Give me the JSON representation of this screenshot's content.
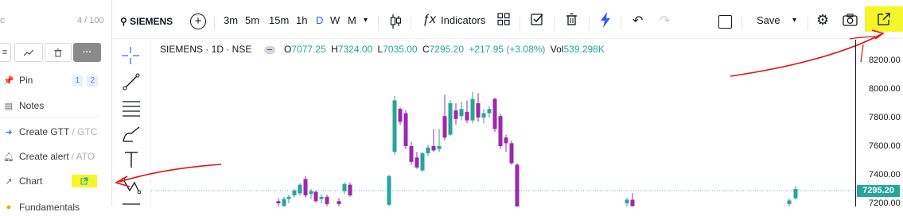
{
  "left_panel": {
    "search_fragment": "c",
    "count": "4 / 100",
    "items": [
      {
        "label": "Pin",
        "badges": [
          "1",
          "2"
        ]
      },
      {
        "label": "Notes"
      },
      {
        "label": "Create GTT",
        "suffix": "/ GTC"
      },
      {
        "label": "Create alert",
        "suffix": "/ ATO"
      },
      {
        "label": "Chart"
      },
      {
        "label": "Fundamentals"
      }
    ]
  },
  "toolbar": {
    "symbol": "SIEMENS",
    "intervals": [
      "3m",
      "5m",
      "15m",
      "1h",
      "D",
      "W",
      "M"
    ],
    "active_interval": "D",
    "indicators_label": "Indicators",
    "save_label": "Save"
  },
  "info": {
    "title": "SIEMENS · 1D · NSE",
    "o_label": "O",
    "o": "7077.25",
    "h_label": "H",
    "h": "7324.00",
    "l_label": "L",
    "l": "7035.00",
    "c_label": "C",
    "c": "7295.20",
    "change": "+217.95 (+3.08%)",
    "vol_label": "Vol",
    "vol": "539.298K"
  },
  "price_axis": {
    "ticks": [
      "8200.00",
      "8000.00",
      "7800.00",
      "7600.00",
      "7400.00",
      "7200.00"
    ],
    "last_price": "7295.20"
  },
  "chart_data": {
    "type": "candlestick",
    "ylim": [
      7160,
      8410
    ],
    "up_color": "#26a69a",
    "down_color": "#9c27b0",
    "candles": [
      {
        "x": 350,
        "o": 7215,
        "h": 7235,
        "l": 7175,
        "c": 7200
      },
      {
        "x": 357,
        "o": 7180,
        "h": 7245,
        "l": 7165,
        "c": 7230
      },
      {
        "x": 363,
        "o": 7230,
        "h": 7260,
        "l": 7200,
        "c": 7245
      },
      {
        "x": 370,
        "o": 7255,
        "h": 7300,
        "l": 7240,
        "c": 7290
      },
      {
        "x": 377,
        "o": 7270,
        "h": 7340,
        "l": 7255,
        "c": 7330
      },
      {
        "x": 384,
        "o": 7370,
        "h": 7390,
        "l": 7240,
        "c": 7255
      },
      {
        "x": 391,
        "o": 7265,
        "h": 7300,
        "l": 7230,
        "c": 7285
      },
      {
        "x": 397,
        "o": 7280,
        "h": 7290,
        "l": 7205,
        "c": 7215
      },
      {
        "x": 404,
        "o": 7230,
        "h": 7265,
        "l": 7200,
        "c": 7245
      },
      {
        "x": 411,
        "o": 7245,
        "h": 7260,
        "l": 7180,
        "c": 7195
      },
      {
        "x": 426,
        "o": 7215,
        "h": 7235,
        "l": 7180,
        "c": 7195
      },
      {
        "x": 433,
        "o": 7285,
        "h": 7345,
        "l": 7265,
        "c": 7335
      },
      {
        "x": 440,
        "o": 7330,
        "h": 7345,
        "l": 7245,
        "c": 7255
      },
      {
        "x": 489,
        "o": 7190,
        "h": 7400,
        "l": 7180,
        "c": 7390
      },
      {
        "x": 496,
        "o": 7560,
        "h": 7950,
        "l": 7540,
        "c": 7920
      },
      {
        "x": 503,
        "o": 7860,
        "h": 7870,
        "l": 7750,
        "c": 7770
      },
      {
        "x": 510,
        "o": 7830,
        "h": 7850,
        "l": 7580,
        "c": 7600
      },
      {
        "x": 517,
        "o": 7600,
        "h": 7630,
        "l": 7470,
        "c": 7490
      },
      {
        "x": 524,
        "o": 7520,
        "h": 7560,
        "l": 7440,
        "c": 7450
      },
      {
        "x": 531,
        "o": 7430,
        "h": 7560,
        "l": 7420,
        "c": 7550
      },
      {
        "x": 538,
        "o": 7550,
        "h": 7610,
        "l": 7530,
        "c": 7590
      },
      {
        "x": 545,
        "o": 7600,
        "h": 7720,
        "l": 7560,
        "c": 7570
      },
      {
        "x": 552,
        "o": 7580,
        "h": 7720,
        "l": 7560,
        "c": 7600
      },
      {
        "x": 559,
        "o": 7810,
        "h": 7960,
        "l": 7640,
        "c": 7660
      },
      {
        "x": 566,
        "o": 7680,
        "h": 7920,
        "l": 7670,
        "c": 7900
      },
      {
        "x": 573,
        "o": 7850,
        "h": 7900,
        "l": 7750,
        "c": 7790
      },
      {
        "x": 580,
        "o": 7810,
        "h": 7910,
        "l": 7780,
        "c": 7860
      },
      {
        "x": 587,
        "o": 7840,
        "h": 7920,
        "l": 7760,
        "c": 7780
      },
      {
        "x": 594,
        "o": 7780,
        "h": 7980,
        "l": 7760,
        "c": 7930
      },
      {
        "x": 601,
        "o": 7900,
        "h": 7970,
        "l": 7770,
        "c": 7800
      },
      {
        "x": 608,
        "o": 7800,
        "h": 7860,
        "l": 7760,
        "c": 7830
      },
      {
        "x": 615,
        "o": 7830,
        "h": 7880,
        "l": 7800,
        "c": 7860
      },
      {
        "x": 622,
        "o": 7930,
        "h": 7940,
        "l": 7700,
        "c": 7720
      },
      {
        "x": 629,
        "o": 7810,
        "h": 7830,
        "l": 7580,
        "c": 7600
      },
      {
        "x": 636,
        "o": 7660,
        "h": 7680,
        "l": 7560,
        "c": 7620
      },
      {
        "x": 643,
        "o": 7620,
        "h": 7640,
        "l": 7470,
        "c": 7480
      },
      {
        "x": 650,
        "o": 7470,
        "h": 7480,
        "l": 7160,
        "c": 7165
      },
      {
        "x": 788,
        "o": 7200,
        "h": 7240,
        "l": 7160,
        "c": 7225
      },
      {
        "x": 795,
        "o": 7225,
        "h": 7270,
        "l": 7160,
        "c": 7180
      },
      {
        "x": 992,
        "o": 7195,
        "h": 7235,
        "l": 7175,
        "c": 7220
      },
      {
        "x": 1000,
        "o": 7235,
        "h": 7320,
        "l": 7225,
        "c": 7300
      }
    ]
  }
}
